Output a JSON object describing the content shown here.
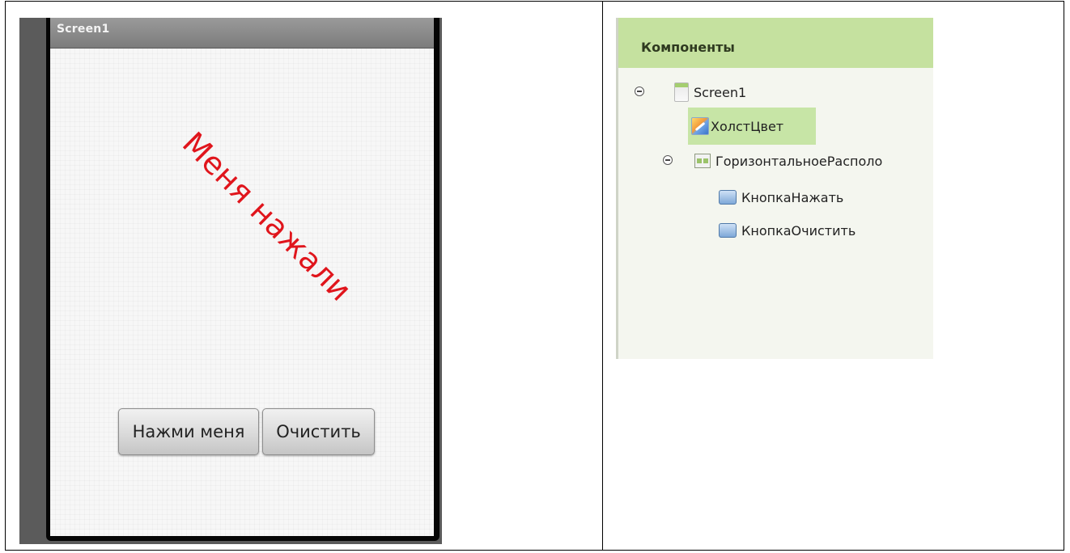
{
  "phone": {
    "screen_title": "Screen1",
    "canvas_text": "Меня нажали",
    "canvas_text_color": "#e0151c",
    "buttons": {
      "press_label": "Нажми меня",
      "clear_label": "Очистить"
    }
  },
  "components": {
    "header": "Компоненты",
    "header_color": "#c5e19f",
    "tree": [
      {
        "label": "Screen1",
        "icon": "screen-icon",
        "expanded": true
      },
      {
        "label": "ХолстЦвет",
        "icon": "canvas-icon",
        "selected": true
      },
      {
        "label": "ГоризонтальноеРасполо",
        "icon": "horizontal-arrangement-icon",
        "expanded": true
      },
      {
        "label": "КнопкаНажать",
        "icon": "button-icon"
      },
      {
        "label": "КнопкаОчистить",
        "icon": "button-icon"
      }
    ]
  }
}
